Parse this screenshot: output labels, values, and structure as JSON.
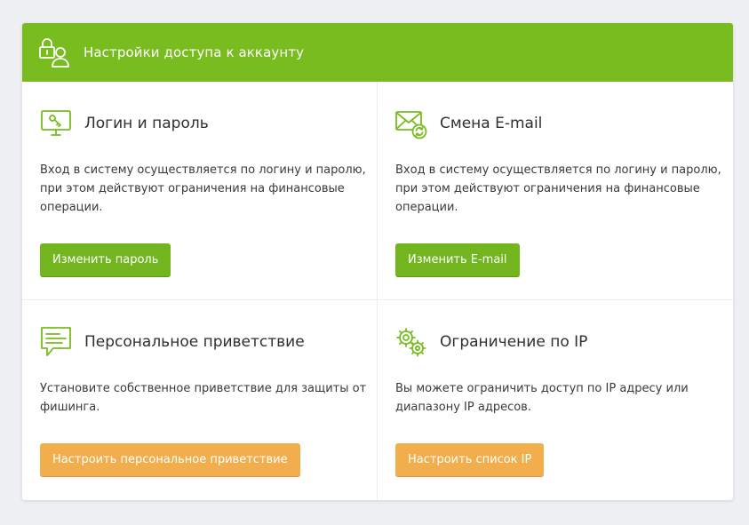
{
  "header": {
    "title": "Настройки доступа к аккаунту",
    "icon": "lock-user-icon"
  },
  "colors": {
    "brand_green": "#78bc1f",
    "button_green": "#72b51e",
    "button_orange": "#f2ad4d"
  },
  "sections": [
    {
      "icon": "monitor-key-icon",
      "title": "Логин и пароль",
      "description": "Вход в систему осуществляется по логину и паролю, при этом действуют ограничения на финансовые операции.",
      "button_label": "Изменить пароль"
    },
    {
      "icon": "envelope-refresh-icon",
      "title": "Смена E-mail",
      "description": "Вход в систему осуществляется по логину и паролю, при этом действуют ограничения на финансовые операции.",
      "button_label": "Изменить E-mail"
    },
    {
      "icon": "speech-bubble-icon",
      "title": "Персональное приветствие",
      "description": "Установите собственное приветствие для защиты от фишинга.",
      "button_label": "Настроить персональное приветствие"
    },
    {
      "icon": "gears-icon",
      "title": "Ограничение по IP",
      "description": "Вы можете ограничить доступ по IP адресу или диапазону IP адресов.",
      "button_label": "Настроить список IP"
    }
  ]
}
